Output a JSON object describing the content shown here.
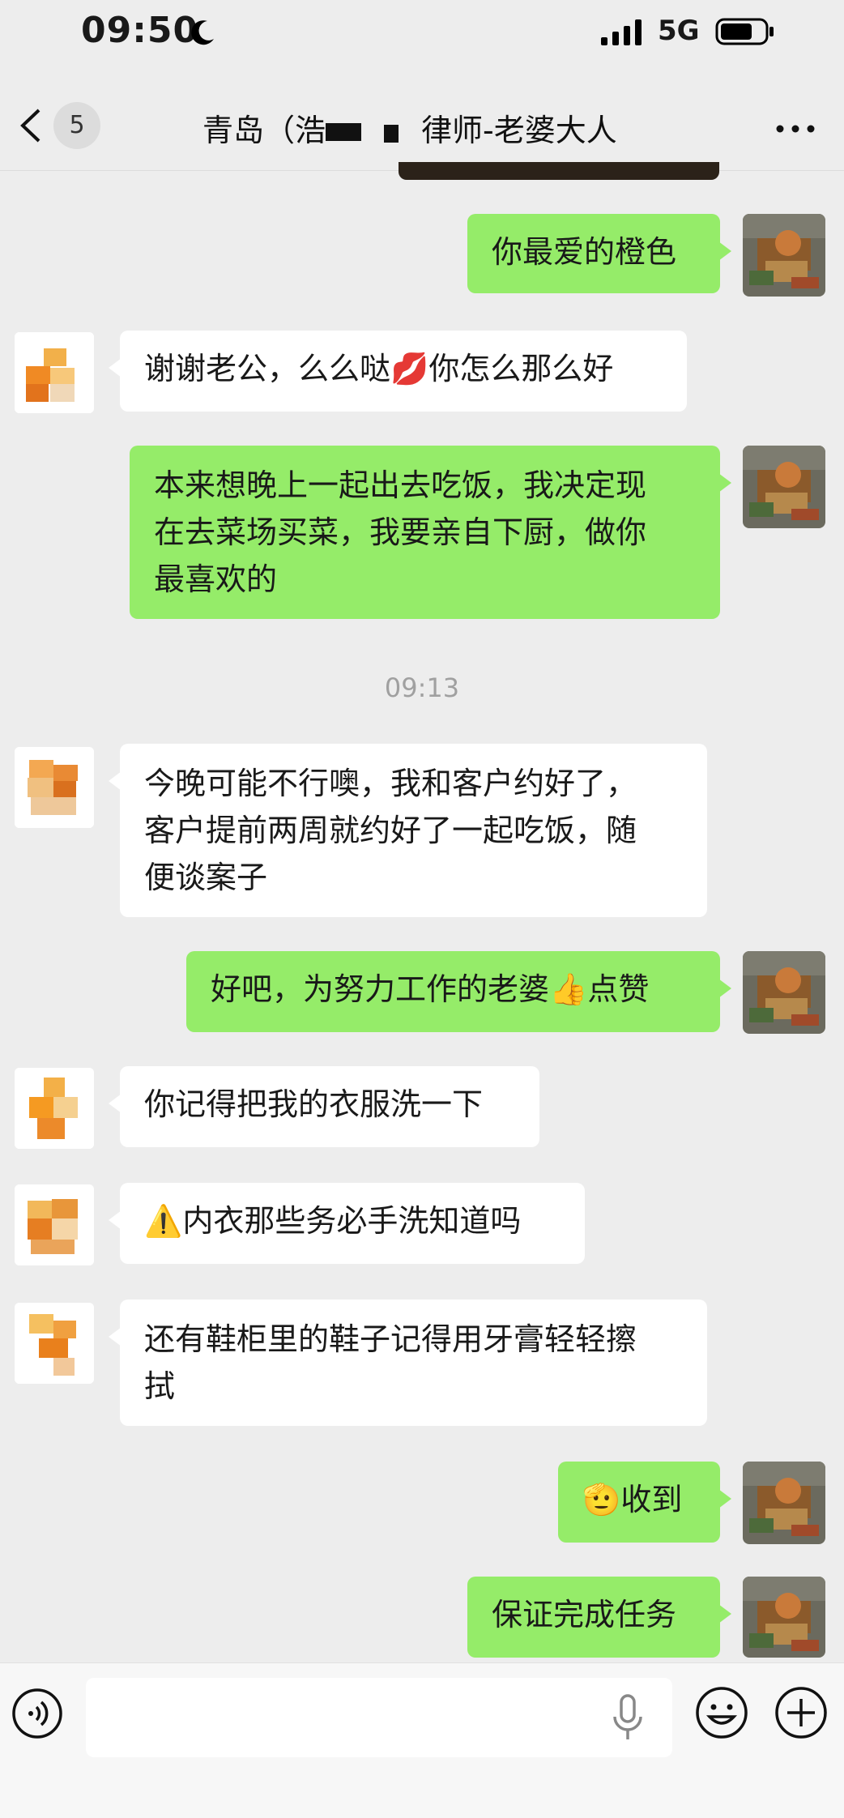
{
  "status_bar": {
    "time": "09:50",
    "network": "5G"
  },
  "nav": {
    "unread_count": "5",
    "title": "青岛（浩",
    "title_tail": "律师-老婆大人"
  },
  "timestamp": "09:13",
  "messages": [
    {
      "from": "me",
      "text": "你最爱的橙色"
    },
    {
      "from": "them",
      "text": "谢谢老公，么么哒",
      "emoji": "💋",
      "text2": "你怎么那么好"
    },
    {
      "from": "me",
      "line1": "本来想晚上一起出去吃饭，我决定现",
      "line2": "在去菜场买菜，我要亲自下厨，做你",
      "line3": "最喜欢的"
    },
    {
      "from": "them",
      "line1": "今晚可能不行噢，我和客户约好了，",
      "line2": "客户提前两周就约好了一起吃饭，随",
      "line3": "便谈案子"
    },
    {
      "from": "me",
      "text": "好吧，为努力工作的老婆",
      "emoji": "👍",
      "text2": "点赞"
    },
    {
      "from": "them",
      "text": "你记得把我的衣服洗一下"
    },
    {
      "from": "them",
      "emoji": "⚠️",
      "text": "内衣那些务必手洗知道吗"
    },
    {
      "from": "them",
      "line1": "还有鞋柜里的鞋子记得用牙膏轻轻擦",
      "line2": "拭"
    },
    {
      "from": "me",
      "emoji": "🫡",
      "text": "收到"
    },
    {
      "from": "me",
      "text": "保证完成任务"
    }
  ],
  "colors": {
    "my_bubble": "#95ec69",
    "their_bubble": "#ffffff",
    "background": "#ededed"
  },
  "icons": [
    "back-icon",
    "more-icon",
    "voice-icon",
    "mic-icon",
    "emoji-icon",
    "plus-icon"
  ]
}
